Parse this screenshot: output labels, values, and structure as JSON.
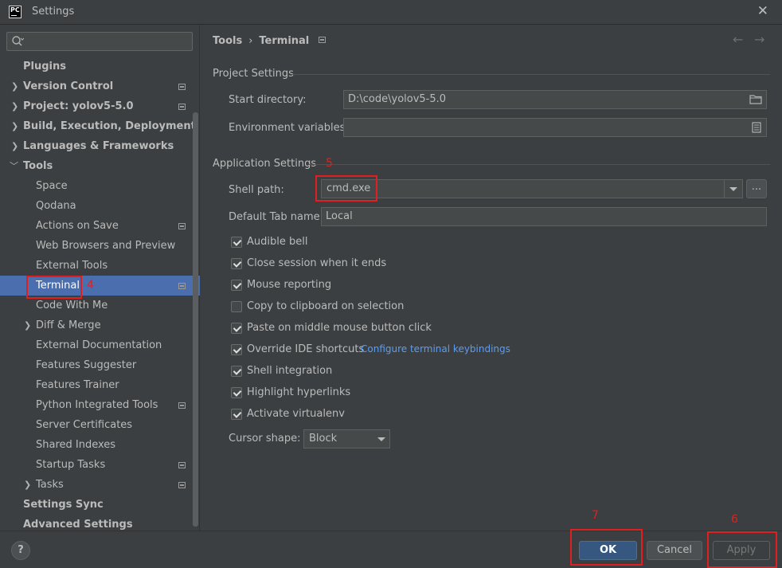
{
  "window": {
    "title": "Settings",
    "logo_text": "PC"
  },
  "sidebar": {
    "search_placeholder": "",
    "items": [
      {
        "label": "Plugins"
      },
      {
        "label": "Version Control"
      },
      {
        "label": "Project: yolov5-5.0"
      },
      {
        "label": "Build, Execution, Deployment"
      },
      {
        "label": "Languages & Frameworks"
      },
      {
        "label": "Tools"
      },
      {
        "label": "Space"
      },
      {
        "label": "Qodana"
      },
      {
        "label": "Actions on Save"
      },
      {
        "label": "Web Browsers and Preview"
      },
      {
        "label": "External Tools"
      },
      {
        "label": "Terminal"
      },
      {
        "label": "Code With Me"
      },
      {
        "label": "Diff & Merge"
      },
      {
        "label": "External Documentation"
      },
      {
        "label": "Features Suggester"
      },
      {
        "label": "Features Trainer"
      },
      {
        "label": "Python Integrated Tools"
      },
      {
        "label": "Server Certificates"
      },
      {
        "label": "Shared Indexes"
      },
      {
        "label": "Startup Tasks"
      },
      {
        "label": "Tasks"
      },
      {
        "label": "Settings Sync"
      },
      {
        "label": "Advanced Settings"
      }
    ]
  },
  "breadcrumb": {
    "parent": "Tools",
    "separator": "›",
    "current": "Terminal"
  },
  "project_settings": {
    "title": "Project Settings",
    "start_directory_label": "Start directory:",
    "start_directory_value": "D:\\code\\yolov5-5.0",
    "env_vars_label": "Environment variables:",
    "env_vars_value": ""
  },
  "app_settings": {
    "title": "Application Settings",
    "shell_path_label": "Shell path:",
    "shell_path_value": "cmd.exe",
    "browse_label": "...",
    "default_tab_label": "Default Tab name:",
    "default_tab_value": "Local",
    "checkboxes": [
      {
        "label": "Audible bell",
        "checked": true
      },
      {
        "label": "Close session when it ends",
        "checked": true
      },
      {
        "label": "Mouse reporting",
        "checked": true
      },
      {
        "label": "Copy to clipboard on selection",
        "checked": false
      },
      {
        "label": "Paste on middle mouse button click",
        "checked": true
      },
      {
        "label": "Override IDE shortcuts",
        "checked": true
      },
      {
        "label": "Shell integration",
        "checked": true
      },
      {
        "label": "Highlight hyperlinks",
        "checked": true
      },
      {
        "label": "Activate virtualenv",
        "checked": true
      }
    ],
    "keybindings_link": "Configure terminal keybindings",
    "cursor_shape_label": "Cursor shape:",
    "cursor_shape_value": "Block"
  },
  "footer": {
    "help_label": "?",
    "ok_label": "OK",
    "cancel_label": "Cancel",
    "apply_label": "Apply"
  },
  "annotations": {
    "n4": "4",
    "n5": "5",
    "n6": "6",
    "n7": "7"
  },
  "colors": {
    "background": "#3c3f41",
    "selection": "#4b6eaf",
    "link": "#589df6",
    "ok_button": "#365880",
    "annotation": "#e02020"
  }
}
